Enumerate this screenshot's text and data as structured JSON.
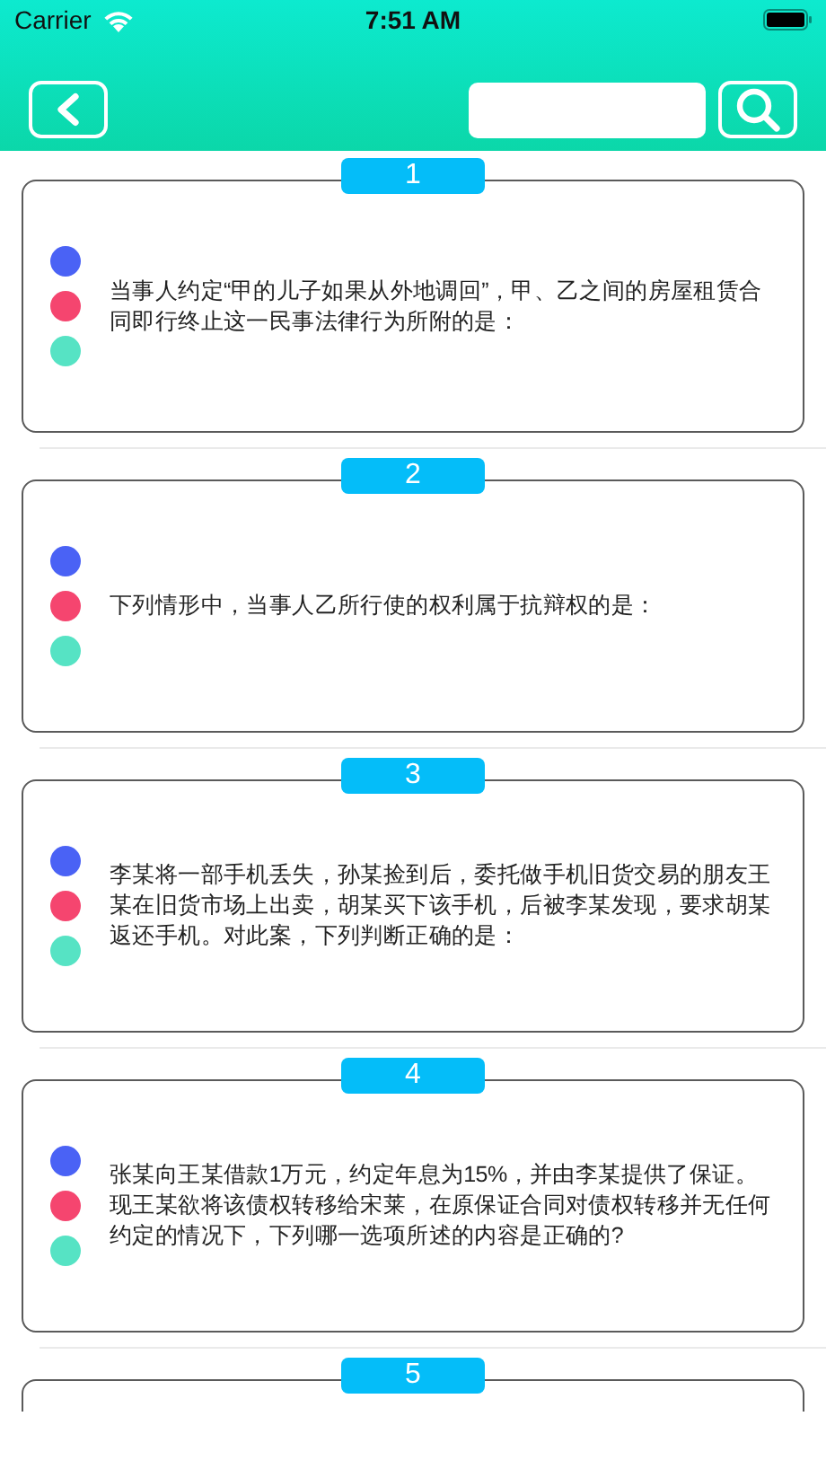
{
  "status_bar": {
    "carrier": "Carrier",
    "time": "7:51 AM"
  },
  "questions": [
    {
      "number": "1",
      "text": "当事人约定“甲的儿子如果从外地调回”，甲、乙之间的房屋租赁合同即行终止这一民事法律行为所附的是：",
      "dots": [
        {
          "color": "#4a62f5"
        },
        {
          "color": "#f5456f"
        },
        {
          "color": "#56e3c4"
        }
      ]
    },
    {
      "number": "2",
      "text": "下列情形中，当事人乙所行使的权利属于抗辩权的是：",
      "dots": [
        {
          "color": "#4a62f5"
        },
        {
          "color": "#f5456f"
        },
        {
          "color": "#56e3c4"
        }
      ]
    },
    {
      "number": "3",
      "text": "李某将一部手机丢失，孙某捡到后，委托做手机旧货交易的朋友王某在旧货市场上出卖，胡某买下该手机，后被李某发现，要求胡某返还手机。对此案，下列判断正确的是：",
      "dots": [
        {
          "color": "#4a62f5"
        },
        {
          "color": "#f5456f"
        },
        {
          "color": "#56e3c4"
        }
      ]
    },
    {
      "number": "4",
      "text": "张某向王某借款1万元，约定年息为15%，并由李某提供了保证。现王某欲将该债权转移给宋莱，在原保证合同对债权转移并无任何约定的情况下，下列哪一选项所述的内容是正确的?",
      "dots": [
        {
          "color": "#4a62f5"
        },
        {
          "color": "#f5456f"
        },
        {
          "color": "#56e3c4"
        }
      ]
    },
    {
      "number": "5"
    }
  ]
}
